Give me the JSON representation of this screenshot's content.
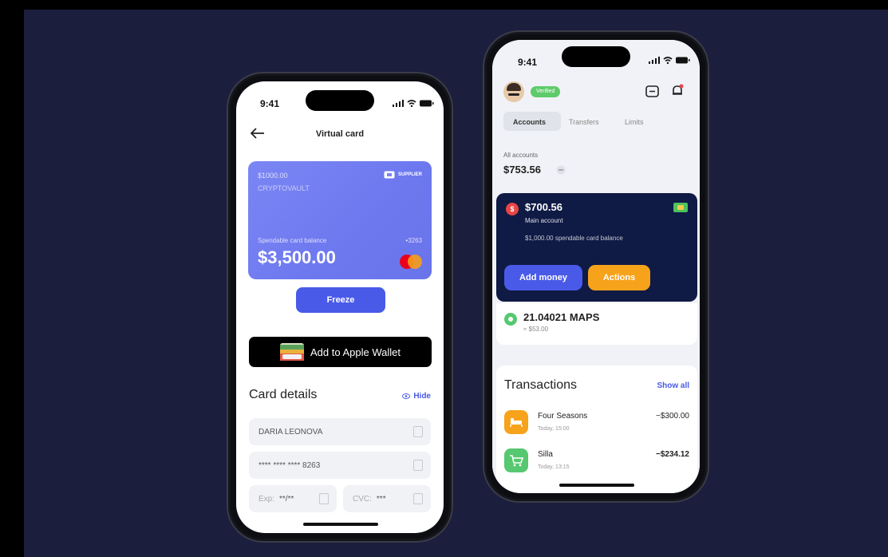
{
  "phone1": {
    "time": "9:41",
    "title": "Virtual card",
    "card": {
      "line1": "$1000.00",
      "line2": "CRYPTOVAULT",
      "brand": "SUPPLIER",
      "balance_label": "Spendable card balance",
      "last_digits": "•3263",
      "balance": "$3,500.00"
    },
    "freeze_label": "Freeze",
    "wallet_label": "Add to Apple Wallet",
    "details_title": "Card details",
    "hide_label": "Hide",
    "fields": {
      "name": "DARIA LEONOVA",
      "number": "**** **** **** 8263",
      "exp_label": "Exp:",
      "exp_value": "**/**",
      "cvc_label": "CVC:",
      "cvc_value": "***"
    }
  },
  "phone2": {
    "time": "9:41",
    "badge": "Verified",
    "tabs": [
      "Accounts",
      "Transfers",
      "Limits"
    ],
    "total_label": "All accounts",
    "total_value": "$753.56",
    "main_account": {
      "amount": "$700.56",
      "name": "Main account",
      "spendable": "$1,000.00 spendable card balance",
      "add_money": "Add money",
      "actions": "Actions"
    },
    "maps": {
      "amount": "21.04021 MAPS",
      "sub": "≈ $53.00"
    },
    "transactions_title": "Transactions",
    "show_all": "Show all",
    "transactions": [
      {
        "name": "Four Seasons",
        "time": "Today, 15:00",
        "amount": "−$300.00"
      },
      {
        "name": "Silla",
        "time": "Today, 13:15",
        "amount": "−$234.12"
      }
    ]
  },
  "colors": {
    "background": "#1b1e3d",
    "card_blue": "#7b86f4",
    "primary": "#4a5ae8",
    "dark_card": "#0f1a45",
    "orange": "#f7a21b",
    "green": "#55c870"
  }
}
